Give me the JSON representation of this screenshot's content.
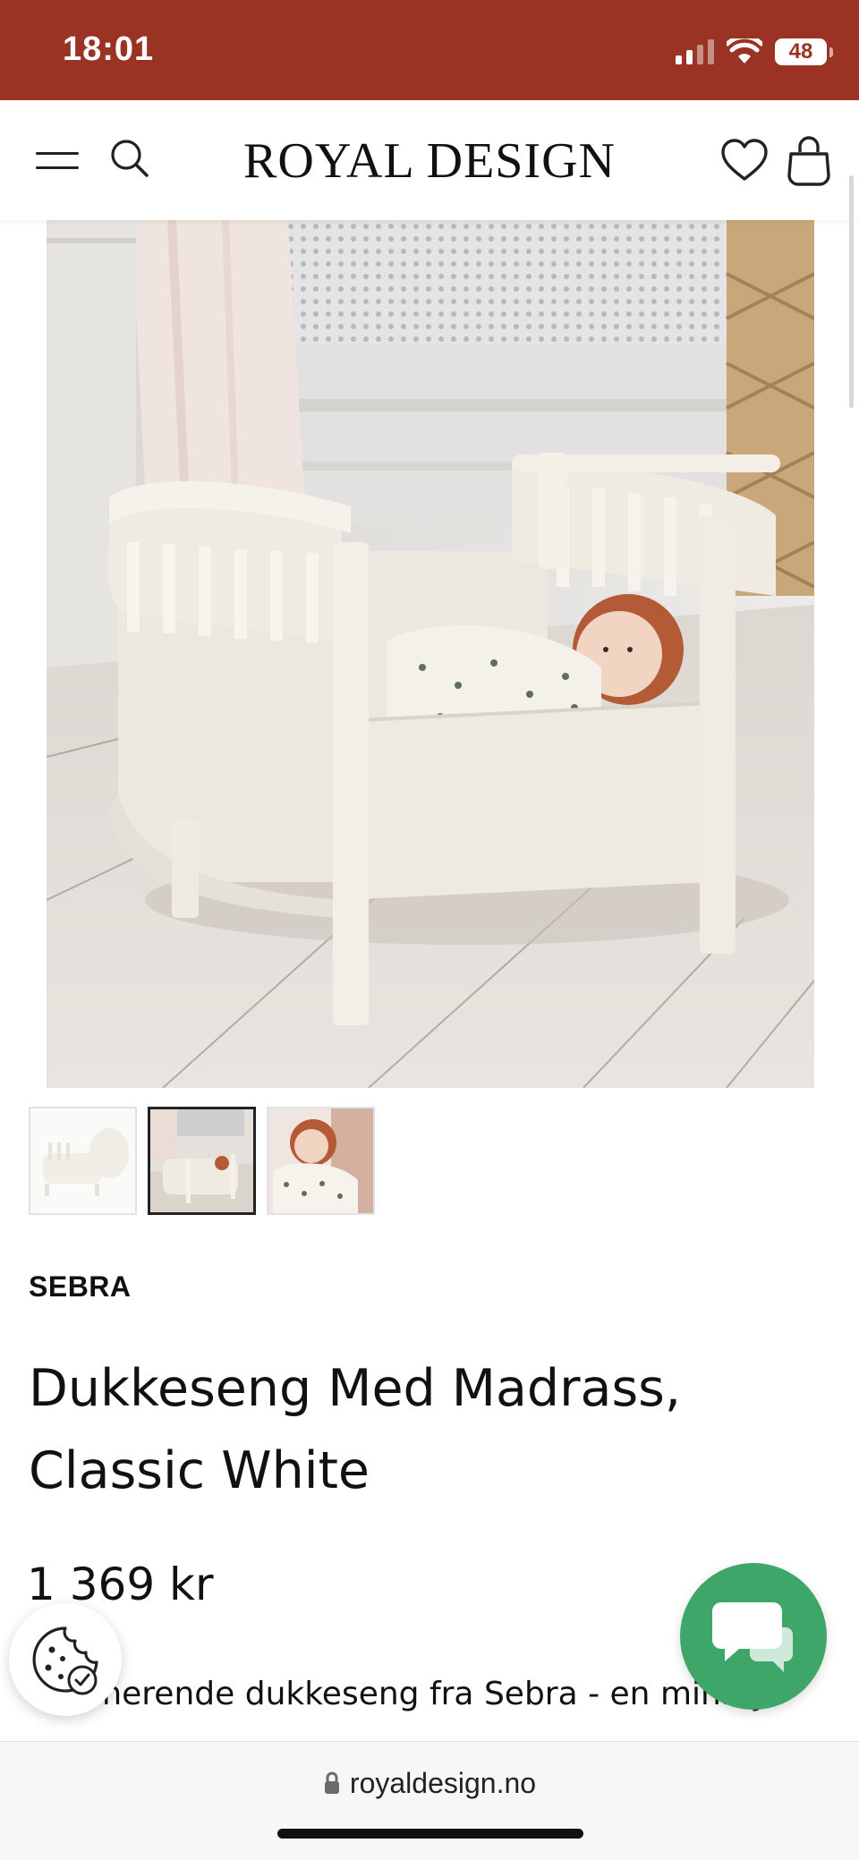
{
  "status_bar": {
    "time": "18:01",
    "battery": "48",
    "background_color": "#9b3324"
  },
  "header": {
    "logo": "ROYAL DESIGN",
    "icons": [
      "menu-icon",
      "search-icon",
      "heart-icon",
      "shopping-bag-icon"
    ]
  },
  "gallery": {
    "thumbnail_count": 3,
    "selected_thumbnail": 2
  },
  "product": {
    "brand": "SEBRA",
    "title_line1": "Dukkeseng Med Madrass,",
    "title_line2": "Classic White",
    "price": "1 369 kr",
    "description": "Sjarmerende dukkeseng fra Sebra - en minidyr"
  },
  "floating": {
    "cookie_icon": "cookie-settings-icon",
    "chat_icon": "chat-icon",
    "chat_color": "#3fa66a"
  },
  "browser": {
    "url": "royaldesign.no"
  }
}
